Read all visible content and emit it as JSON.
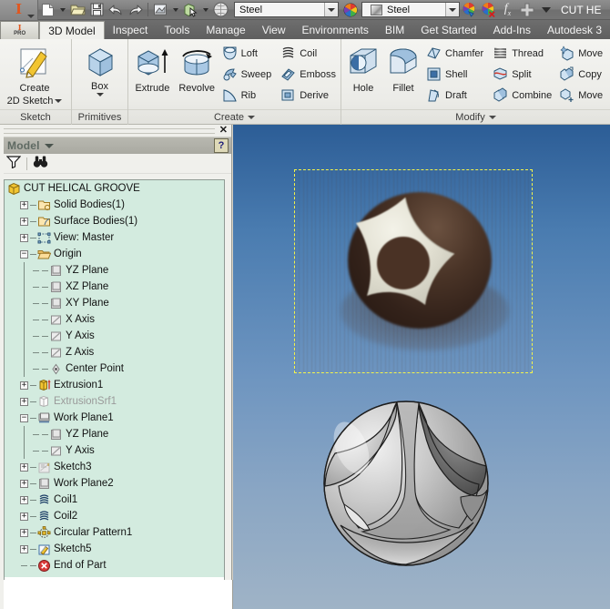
{
  "app": {
    "name": "Autodesk Inventor Professional",
    "logo_letter": "I",
    "logo_sub": "PRO",
    "document_title": "CUT HE"
  },
  "quick_access": {
    "items": [
      {
        "name": "new-document",
        "icon": "new-file-icon",
        "has_dropdown": true
      },
      {
        "name": "open-document",
        "icon": "open-folder-icon",
        "has_dropdown": false
      },
      {
        "name": "save-document",
        "icon": "floppy-save-icon",
        "has_dropdown": false
      },
      {
        "name": "undo",
        "icon": "undo-arrow-icon",
        "has_dropdown": false
      },
      {
        "name": "redo",
        "icon": "redo-arrow-icon",
        "has_dropdown": false
      },
      {
        "name": "update",
        "icon": "update-icon",
        "has_dropdown": true
      },
      {
        "name": "select",
        "icon": "select-cursor-icon",
        "has_dropdown": true
      },
      {
        "name": "material-sphere",
        "icon": "sphere-icon",
        "has_dropdown": false
      }
    ],
    "material_combo": {
      "value": "Steel",
      "placeholder": "Material"
    },
    "appearance_combo": {
      "value": "Steel",
      "placeholder": "Appearance"
    },
    "right_icons": [
      {
        "name": "adjust-appearance",
        "icon": "color-wheel-paint-icon"
      },
      {
        "name": "clear-appearance",
        "icon": "color-wheel-clear-icon"
      },
      {
        "name": "parameters",
        "icon": "fx-parameters-icon"
      },
      {
        "name": "add-tool",
        "icon": "plus-icon"
      },
      {
        "name": "customize-qat",
        "icon": "chevron-down-icon"
      }
    ]
  },
  "ribbon": {
    "tabs": [
      {
        "label": "3D Model",
        "active": true
      },
      {
        "label": "Inspect",
        "active": false
      },
      {
        "label": "Tools",
        "active": false
      },
      {
        "label": "Manage",
        "active": false
      },
      {
        "label": "View",
        "active": false
      },
      {
        "label": "Environments",
        "active": false
      },
      {
        "label": "BIM",
        "active": false
      },
      {
        "label": "Get Started",
        "active": false
      },
      {
        "label": "Add-Ins",
        "active": false
      },
      {
        "label": "Autodesk 3",
        "active": false
      }
    ],
    "panels": [
      {
        "label": "Sketch",
        "has_caret": false,
        "big_buttons": [
          {
            "label": "Create\n2D Sketch",
            "label_line1": "Create",
            "label_line2": "2D Sketch",
            "icon": "create-sketch-icon",
            "has_caret": true
          }
        ],
        "small_buttons": []
      },
      {
        "label": "Primitives",
        "has_caret": false,
        "big_buttons": [
          {
            "label_line1": "Box",
            "label_line2": "",
            "icon": "box-icon",
            "has_caret": true
          }
        ],
        "small_buttons": []
      },
      {
        "label": "Create",
        "has_caret": true,
        "big_buttons": [
          {
            "label_line1": "Extrude",
            "label_line2": "",
            "icon": "extrude-icon",
            "has_caret": false
          },
          {
            "label_line1": "Revolve",
            "label_line2": "",
            "icon": "revolve-icon",
            "has_caret": false
          }
        ],
        "small_buttons": [
          {
            "label": "Loft",
            "icon": "loft-icon"
          },
          {
            "label": "Sweep",
            "icon": "sweep-icon"
          },
          {
            "label": "Rib",
            "icon": "rib-icon"
          },
          {
            "label": "Coil",
            "icon": "coil-icon"
          },
          {
            "label": "Emboss",
            "icon": "emboss-icon"
          },
          {
            "label": "Derive",
            "icon": "derive-icon"
          }
        ]
      },
      {
        "label": "Modify",
        "has_caret": true,
        "big_buttons": [
          {
            "label_line1": "Hole",
            "label_line2": "",
            "icon": "hole-icon",
            "has_caret": false
          },
          {
            "label_line1": "Fillet",
            "label_line2": "",
            "icon": "fillet-icon",
            "has_caret": false
          }
        ],
        "small_buttons": [
          {
            "label": "Chamfer",
            "icon": "chamfer-icon"
          },
          {
            "label": "Shell",
            "icon": "shell-icon"
          },
          {
            "label": "Draft",
            "icon": "draft-icon"
          },
          {
            "label": "Thread",
            "icon": "thread-icon"
          },
          {
            "label": "Split",
            "icon": "split-icon"
          },
          {
            "label": "Combine",
            "icon": "combine-icon"
          },
          {
            "label": "Move",
            "icon": "move-face-icon"
          },
          {
            "label": "Copy",
            "icon": "copy-object-icon"
          },
          {
            "label": "Move",
            "icon": "move-bodies-icon"
          }
        ]
      }
    ]
  },
  "browser": {
    "title": "Model",
    "close_label": "✕",
    "help_label": "?",
    "toolbar": [
      {
        "name": "filter-button",
        "icon": "filter-funnel-icon"
      },
      {
        "name": "find-button",
        "icon": "binoculars-find-icon"
      }
    ],
    "tree": [
      {
        "label": "CUT HELICAL GROOVE",
        "depth": 0,
        "toggle": "none",
        "icon": "part-cube-icon",
        "dim": false
      },
      {
        "label": "Solid Bodies(1)",
        "depth": 1,
        "toggle": "plus",
        "icon": "solid-bodies-icon",
        "dim": false
      },
      {
        "label": "Surface Bodies(1)",
        "depth": 1,
        "toggle": "plus",
        "icon": "surface-bodies-icon",
        "dim": false
      },
      {
        "label": "View: Master",
        "depth": 1,
        "toggle": "plus",
        "icon": "view-master-icon",
        "dim": false
      },
      {
        "label": "Origin",
        "depth": 1,
        "toggle": "minus",
        "icon": "folder-icon",
        "dim": false
      },
      {
        "label": "YZ Plane",
        "depth": 2,
        "toggle": "none",
        "icon": "plane-icon",
        "dim": false
      },
      {
        "label": "XZ Plane",
        "depth": 2,
        "toggle": "none",
        "icon": "plane-icon",
        "dim": false
      },
      {
        "label": "XY Plane",
        "depth": 2,
        "toggle": "none",
        "icon": "plane-icon",
        "dim": false
      },
      {
        "label": "X Axis",
        "depth": 2,
        "toggle": "none",
        "icon": "axis-icon",
        "dim": false
      },
      {
        "label": "Y Axis",
        "depth": 2,
        "toggle": "none",
        "icon": "axis-icon",
        "dim": false
      },
      {
        "label": "Z Axis",
        "depth": 2,
        "toggle": "none",
        "icon": "axis-icon",
        "dim": false
      },
      {
        "label": "Center Point",
        "depth": 2,
        "toggle": "none",
        "icon": "center-point-icon",
        "dim": false
      },
      {
        "label": "Extrusion1",
        "depth": 1,
        "toggle": "plus",
        "icon": "extrusion-icon",
        "dim": false
      },
      {
        "label": "ExtrusionSrf1",
        "depth": 1,
        "toggle": "plus",
        "icon": "extrusion-srf-icon",
        "dim": true
      },
      {
        "label": "Work Plane1",
        "depth": 1,
        "toggle": "minus",
        "icon": "work-plane-icon",
        "dim": false
      },
      {
        "label": "YZ Plane",
        "depth": 2,
        "toggle": "none",
        "icon": "plane-icon",
        "dim": false
      },
      {
        "label": "Y Axis",
        "depth": 2,
        "toggle": "none",
        "icon": "axis-icon",
        "dim": false
      },
      {
        "label": "Sketch3",
        "depth": 1,
        "toggle": "plus",
        "icon": "sketch-dim-icon",
        "dim": false
      },
      {
        "label": "Work Plane2",
        "depth": 1,
        "toggle": "plus",
        "icon": "plane-icon",
        "dim": false
      },
      {
        "label": "Coil1",
        "depth": 1,
        "toggle": "plus",
        "icon": "coil-icon",
        "dim": false
      },
      {
        "label": "Coil2",
        "depth": 1,
        "toggle": "plus",
        "icon": "coil-icon",
        "dim": false
      },
      {
        "label": "Circular Pattern1",
        "depth": 1,
        "toggle": "plus",
        "icon": "circular-pattern-icon",
        "dim": false
      },
      {
        "label": "Sketch5",
        "depth": 1,
        "toggle": "plus",
        "icon": "sketch-icon",
        "dim": false
      },
      {
        "label": "End of Part",
        "depth": 1,
        "toggle": "none",
        "icon": "end-of-part-icon",
        "dim": false
      }
    ]
  },
  "viewport": {
    "background_top": "#2c5d96",
    "background_bottom": "#9fb3c6",
    "image_selection": {
      "name": "canvas-image",
      "selected": true,
      "handle_color": "#f5f54a"
    },
    "model": {
      "name": "sphere-with-helical-groove",
      "body_color": "#a8a8a8"
    }
  }
}
